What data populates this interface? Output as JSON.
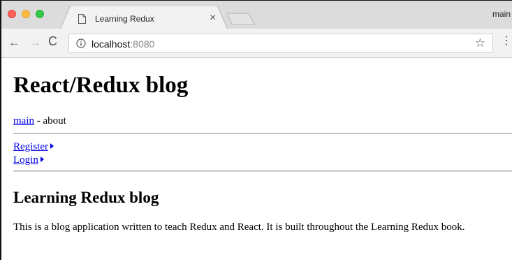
{
  "browser": {
    "tab": {
      "title": "Learning Redux",
      "icon": "page-icon",
      "close": "×"
    },
    "profile_label": "main",
    "toolbar": {
      "back": "←",
      "forward": "→",
      "reload": "C",
      "url_host": "localhost",
      "url_port": ":8080",
      "star": "☆",
      "menu": "⋮"
    }
  },
  "page": {
    "title": "React/Redux blog",
    "nav": {
      "main_link": "main",
      "separator": " - ",
      "about": "about"
    },
    "auth": {
      "register": "Register",
      "login": "Login"
    },
    "section_title": "Learning Redux blog",
    "description": "This is a blog application written to teach Redux and React. It is built throughout the Learning Redux book."
  },
  "colors": {
    "link": "#0000ee",
    "tab_strip": "#dcdcdc",
    "toolbar": "#f2f2f2"
  }
}
